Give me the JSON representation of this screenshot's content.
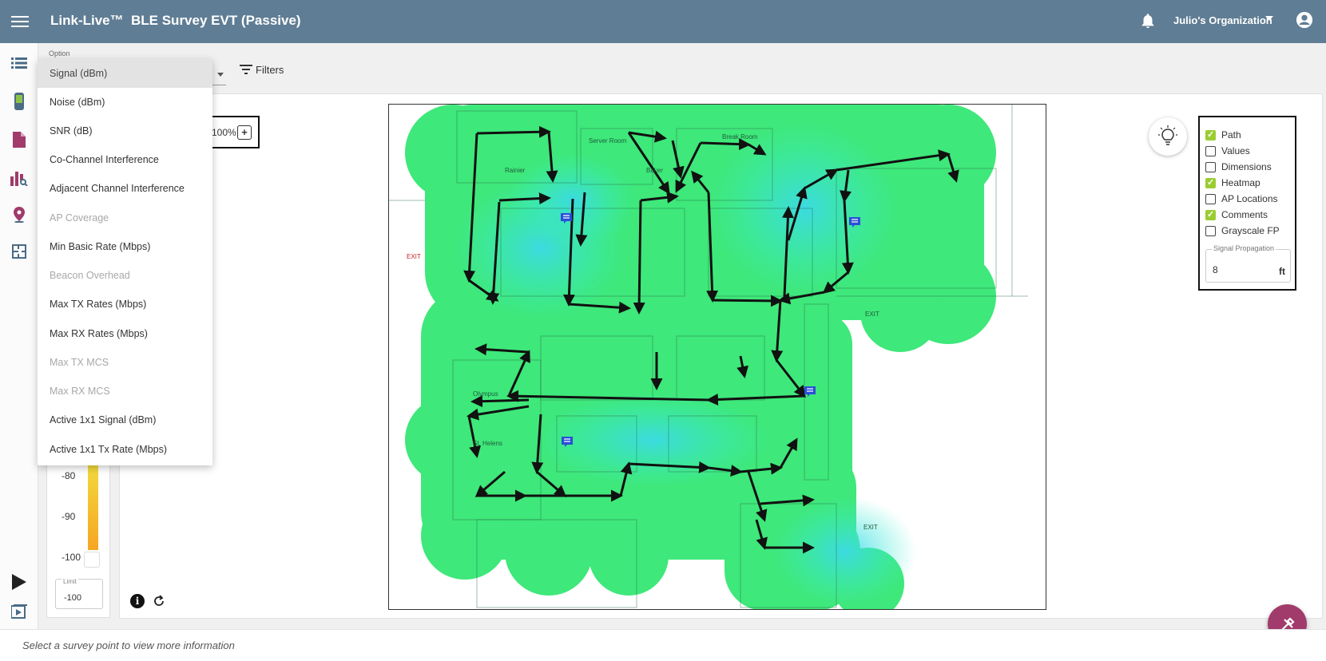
{
  "header": {
    "brand": "Link-Live™",
    "survey_title": "BLE Survey EVT (Passive)",
    "organization": "Julio's Organization"
  },
  "sidebar": {
    "items": [
      {
        "icon": "list-icon"
      },
      {
        "icon": "device-icon",
        "color": "#8bc34a"
      },
      {
        "icon": "document-icon",
        "color": "#a03b6b"
      },
      {
        "icon": "report-chart-icon",
        "color": "#a03b6b"
      },
      {
        "icon": "map-pin-icon",
        "color": "#a03b6b"
      },
      {
        "icon": "floorplan-icon",
        "color": "#4a6b86"
      }
    ]
  },
  "option_menu": {
    "label": "Option",
    "items": [
      {
        "label": "Signal (dBm)",
        "state": "selected"
      },
      {
        "label": "Noise (dBm)",
        "state": "enabled"
      },
      {
        "label": "SNR (dB)",
        "state": "enabled"
      },
      {
        "label": "Co-Channel Interference",
        "state": "enabled"
      },
      {
        "label": "Adjacent Channel Interference",
        "state": "enabled"
      },
      {
        "label": "AP Coverage",
        "state": "disabled"
      },
      {
        "label": "Min Basic Rate (Mbps)",
        "state": "enabled"
      },
      {
        "label": "Beacon Overhead",
        "state": "disabled"
      },
      {
        "label": "Max TX Rates (Mbps)",
        "state": "enabled"
      },
      {
        "label": "Max RX Rates (Mbps)",
        "state": "enabled"
      },
      {
        "label": "Max TX MCS",
        "state": "disabled"
      },
      {
        "label": "Max RX MCS",
        "state": "disabled"
      },
      {
        "label": "Active 1x1 Signal (dBm)",
        "state": "enabled"
      },
      {
        "label": "Active 1x1 Tx Rate (Mbps)",
        "state": "enabled"
      }
    ]
  },
  "toolbar": {
    "filters_label": "Filters",
    "zoom_label": "100%",
    "zoom_in": "+"
  },
  "legend": {
    "ticks": [
      "-80",
      "-90",
      "-100"
    ],
    "limit_label": "Limit",
    "limit_value": "-100"
  },
  "layers": {
    "items": [
      {
        "label": "Path",
        "checked": true
      },
      {
        "label": "Values",
        "checked": false
      },
      {
        "label": "Dimensions",
        "checked": false
      },
      {
        "label": "Heatmap",
        "checked": true
      },
      {
        "label": "AP Locations",
        "checked": false
      },
      {
        "label": "Comments",
        "checked": true
      },
      {
        "label": "Grayscale FP",
        "checked": false
      }
    ],
    "propagation_label": "Signal Propagation",
    "propagation_value": "8",
    "propagation_unit": "ft"
  },
  "floorplan": {
    "room_labels": [
      "Server Room",
      "Break Room",
      "Rainier",
      "Baker",
      "Olympus",
      "St. Helens",
      "EXIT"
    ],
    "heatmap_colors": [
      "#3ee87a",
      "#3cf0c8",
      "#3ad8f2"
    ]
  },
  "status": {
    "text": "Select a survey point to view more information"
  },
  "colors": {
    "topbar": "#5f7d94",
    "accent": "#a03b6b",
    "check": "#9acd32"
  }
}
